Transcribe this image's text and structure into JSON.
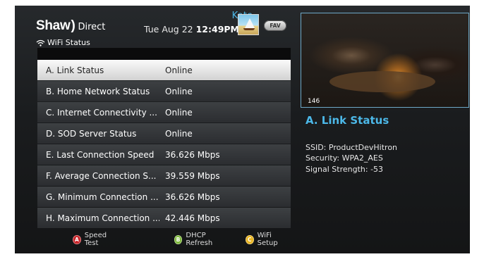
{
  "header": {
    "brand": "Shaw",
    "brand_suffix": "Direct",
    "date": "Tue Aug 22",
    "time": "12:49PM",
    "user": "Kate",
    "fav_label": "FAV",
    "page_title": "WiFi Status"
  },
  "list": {
    "rows": [
      {
        "label": "A. Link Status",
        "value": "Online"
      },
      {
        "label": "B. Home Network Status",
        "value": "Online"
      },
      {
        "label": "C. Internet Connectivity ...",
        "value": "Online"
      },
      {
        "label": "D. SOD Server Status",
        "value": "Online"
      },
      {
        "label": "E. Last Connection Speed",
        "value": "36.626 Mbps"
      },
      {
        "label": "F. Average Connection S...",
        "value": "39.559 Mbps"
      },
      {
        "label": "G. Minimum Connection ...",
        "value": "36.626 Mbps"
      },
      {
        "label": "H. Maximum Connection ...",
        "value": "42.446 Mbps"
      }
    ],
    "selected_index": 0
  },
  "legend": [
    {
      "key": "A",
      "label": "Speed Test",
      "color": "#c8262b"
    },
    {
      "key": "B",
      "label": "DHCP Refresh",
      "color": "#7db83a"
    },
    {
      "key": "C",
      "label": "WiFi Setup",
      "color": "#e8b420"
    }
  ],
  "preview": {
    "channel": "146"
  },
  "detail": {
    "title": "A. Link Status",
    "ssid": "SSID: ProductDevHitron",
    "security": "Security: WPA2_AES",
    "signal": "Signal Strength: -53"
  },
  "colors": {
    "accent": "#4cb8e8"
  },
  "icons": {
    "wifi": "wifi-icon",
    "avatar": "avatar-sailboat"
  }
}
